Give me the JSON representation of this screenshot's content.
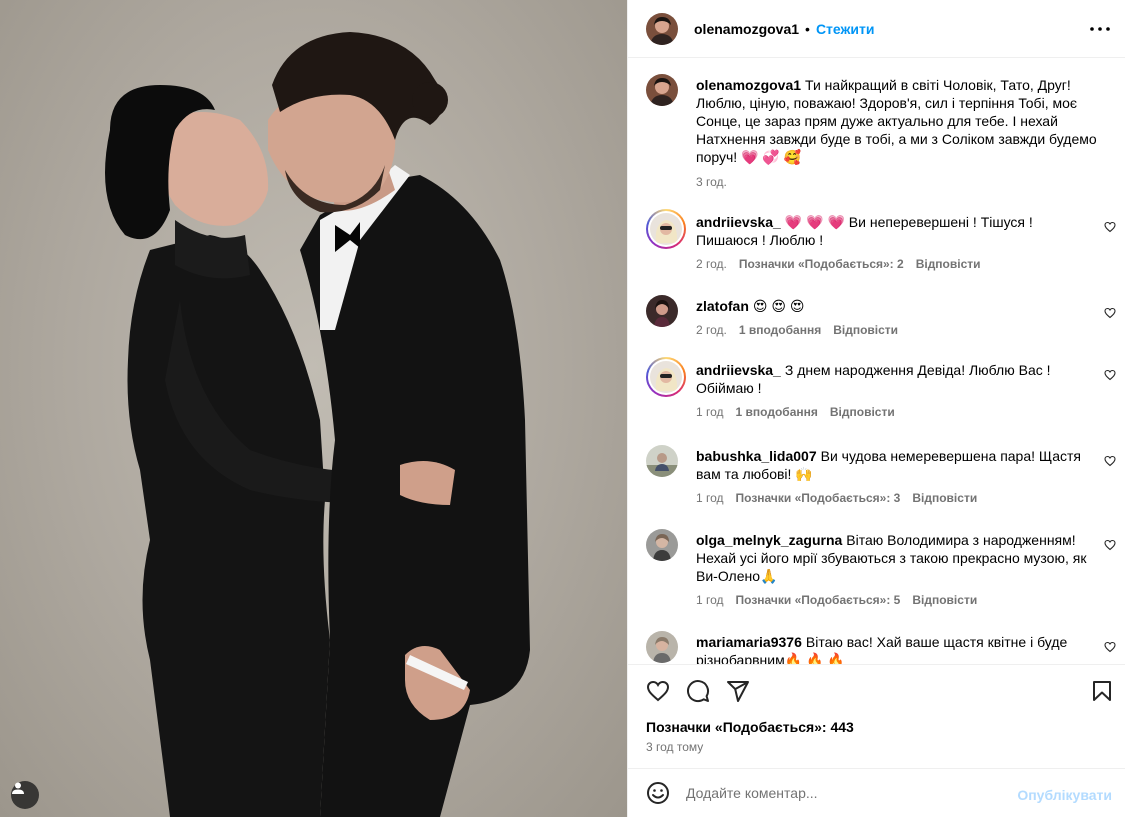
{
  "post": {
    "author": "olenamozgova1",
    "follow_label": "Стежити",
    "separator": "•",
    "caption": "Ти найкращий в світі Чоловік, Тато, Друг! Люблю, ціную, поважаю! Здоров'я, сил і терпіння Тобі, моє Сонце, це зараз прям дуже актуально для тебе. І нехай Натхнення завжди буде в тобі, а ми з Соліком завжди будемо поруч! 💗 💞 🥰",
    "caption_time": "3 год.",
    "likes_text": "Позначки «Подобається»: 443",
    "posted_when": "3 год тому"
  },
  "comments": [
    {
      "user": "andriievska_",
      "text": "💗 💗 💗 Ви неперевершені ! Тішуся ! Пишаюся ! Люблю !",
      "time": "2 год.",
      "likes": "Позначки «Подобається»: 2",
      "reply": "Відповісти"
    },
    {
      "user": "zlatofan",
      "text": "😍 😍 😍",
      "time": "2 год.",
      "likes": "1 вподобання",
      "reply": "Відповісти"
    },
    {
      "user": "andriievska_",
      "text": "З днем народження Девіда! Люблю Вас ! Обіймаю !",
      "time": "1 год",
      "likes": "1 вподобання",
      "reply": "Відповісти"
    },
    {
      "user": "babushka_lida007",
      "text": "Ви чудова немеревершена пара! Щастя вам та любові! 🙌",
      "time": "1 год",
      "likes": "Позначки «Подобається»: 3",
      "reply": "Відповісти"
    },
    {
      "user": "olga_melnyk_zagurna",
      "text": "Вітаю Володимира з народженням! Нехай усі його мрії збуваються з такою прекрасно музою, як Ви-Олено🙏",
      "time": "1 год",
      "likes": "Позначки «Подобається»: 5",
      "reply": "Відповісти"
    },
    {
      "user": "mariamaria9376",
      "text": "Вітаю вас! Хай ваше щастя квітне і буде різнобарвним🔥 🔥 🔥",
      "time": "",
      "likes": "",
      "reply": ""
    }
  ],
  "composer": {
    "placeholder": "Додайте коментар...",
    "post_label": "Опублікувати"
  },
  "icons": {
    "more": "more-horizontal-icon",
    "like": "heart-icon",
    "comment": "comment-icon",
    "share": "share-icon",
    "save": "bookmark-icon",
    "emoji": "emoji-icon",
    "user_tag": "user-tag-icon"
  },
  "colors": {
    "accent": "#0095f6",
    "muted": "#737373",
    "border": "#efefef"
  }
}
